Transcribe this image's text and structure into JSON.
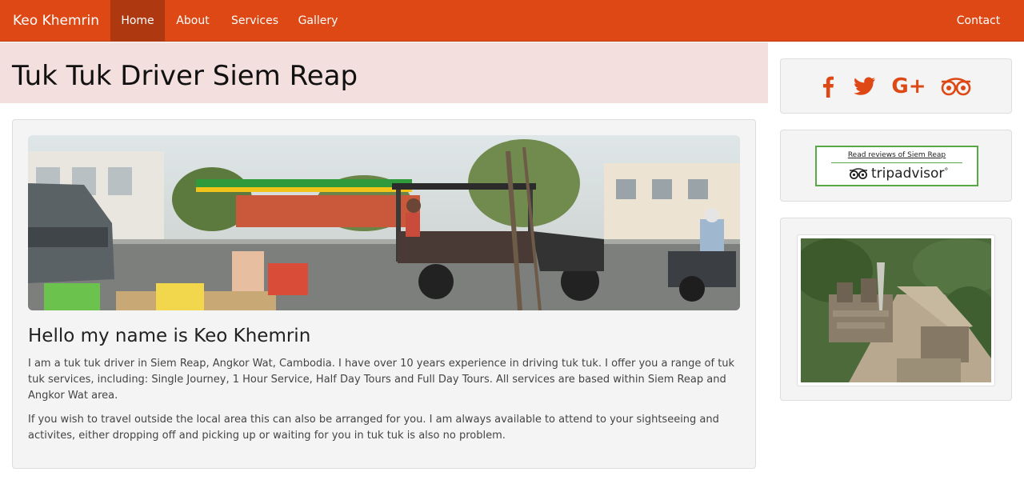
{
  "navbar": {
    "brand": "Keo Khemrin",
    "items": [
      {
        "label": "Home",
        "active": true
      },
      {
        "label": "About"
      },
      {
        "label": "Services"
      },
      {
        "label": "Gallery"
      }
    ],
    "contact": "Contact",
    "color": "#dd4814",
    "active_color": "#ae3910"
  },
  "jumbotron": {
    "title": "Tuk Tuk Driver Siem Reap",
    "background": "#f4dfdf"
  },
  "main": {
    "hero_image": "siem-reap-street-tuk-tuk-photo",
    "heading": "Hello my name is Keo Khemrin",
    "paragraphs": [
      "I am a tuk tuk driver in Siem Reap, Angkor Wat, Cambodia. I have over 10 years experience in driving tuk tuk. I offer you a range of tuk tuk services, including: Single Journey, 1 Hour Service, Half Day Tours and Full Day Tours. All services are based within Siem Reap and Angkor Wat area.",
      "If you wish to travel outside the local area this can also be arranged for you. I am always available to attend to your sightseeing and activites, either dropping off and picking up or waiting for you in tuk tuk is also no problem."
    ]
  },
  "sidebar": {
    "social": [
      {
        "icon": "facebook-icon"
      },
      {
        "icon": "twitter-icon"
      },
      {
        "icon": "google-plus-icon",
        "glyph": "G+"
      },
      {
        "icon": "tripadvisor-icon"
      }
    ],
    "tripadvisor": {
      "link_text": "Read reviews of Siem Reap",
      "logo_text": "tripadvisor",
      "logo_suffix": "°",
      "border_color": "#58a845"
    },
    "photo": "angkor-temple-aerial-photo"
  }
}
